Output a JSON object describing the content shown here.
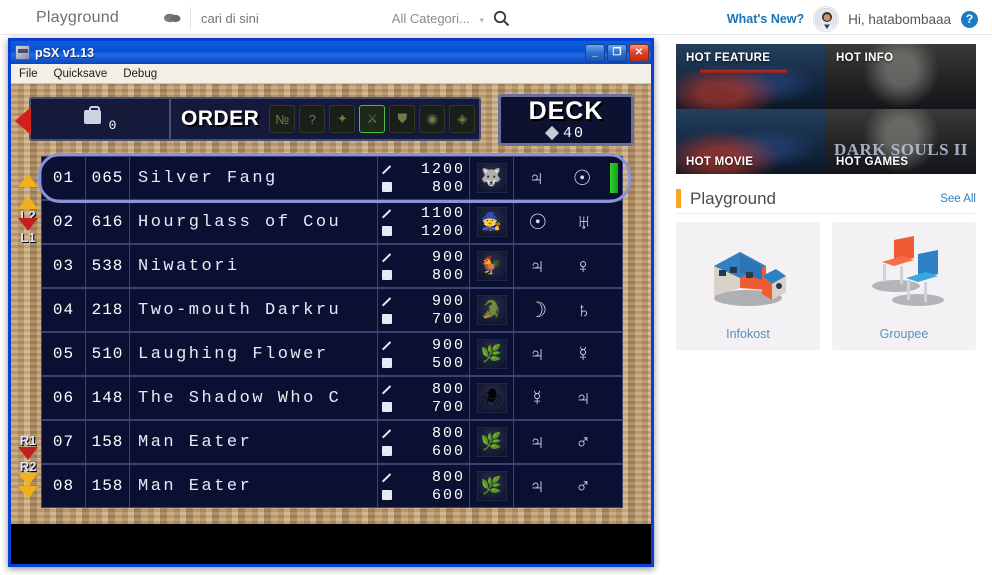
{
  "browser": {
    "brand": "Playground",
    "search": {
      "placeholder": "cari di sini",
      "category": "All Categori...",
      "category_caret": "▾",
      "search_icon": "search-icon",
      "bubble_icon": "chat-bubble-icon"
    },
    "header_right": {
      "whats_new": "What's New?",
      "greeting": "Hi, hatabombaaa",
      "help_icon": "?"
    },
    "promos": [
      {
        "label": "HOT FEATURE",
        "art": "avengers"
      },
      {
        "label": "HOT INFO",
        "art": "darksouls-top"
      },
      {
        "label": "HOT MOVIE",
        "art": "avengers-bottom"
      },
      {
        "label": "HOT GAMES",
        "art": "darksouls",
        "art_text": "DARK SOULS II"
      }
    ],
    "section": {
      "title": "Playground",
      "see_all": "See All"
    },
    "cards": [
      {
        "label": "Infokost",
        "icon": "house-isometric-icon"
      },
      {
        "label": "Groupee",
        "icon": "chairs-isometric-icon"
      }
    ]
  },
  "window": {
    "title": "pSX v1.13",
    "minimize": "_",
    "maximize": "❐",
    "close": "✕",
    "menu": [
      "File",
      "Quicksave",
      "Debug"
    ]
  },
  "game": {
    "order": {
      "bag_count": "0",
      "label": "ORDER",
      "filters": [
        {
          "name": "filter-number",
          "glyph": "№",
          "selected": false
        },
        {
          "name": "filter-type",
          "glyph": "?",
          "selected": false
        },
        {
          "name": "filter-monster",
          "glyph": "✦",
          "selected": false
        },
        {
          "name": "filter-attack",
          "glyph": "⚔",
          "selected": true
        },
        {
          "name": "filter-defense",
          "glyph": "⛊",
          "selected": false
        },
        {
          "name": "filter-trap",
          "glyph": "◉",
          "selected": false
        },
        {
          "name": "filter-magic",
          "glyph": "◈",
          "selected": false
        }
      ]
    },
    "deck": {
      "label": "DECK",
      "count": "40"
    },
    "hints_left": [
      {
        "label": "L2",
        "arrow": "up"
      },
      {
        "label": "L1",
        "arrow": "up"
      }
    ],
    "hints_right": [
      {
        "label": "R1",
        "arrow": "down-red"
      },
      {
        "label": "R2",
        "arrow": "down-yellow"
      }
    ],
    "rows": [
      {
        "no": "01",
        "id": "065",
        "name": "Silver Fang",
        "atk": "1200",
        "def": "800",
        "thumb": "🐺",
        "sym1": "♃",
        "sym2": "☉",
        "selected": true
      },
      {
        "no": "02",
        "id": "616",
        "name": "Hourglass of Cou",
        "atk": "1100",
        "def": "1200",
        "thumb": "🧙",
        "sym1": "☉",
        "sym2": "♅",
        "selected": false
      },
      {
        "no": "03",
        "id": "538",
        "name": "Niwatori",
        "atk": "900",
        "def": "800",
        "thumb": "🐓",
        "sym1": "♃",
        "sym2": "♀",
        "selected": false
      },
      {
        "no": "04",
        "id": "218",
        "name": "Two-mouth Darkru",
        "atk": "900",
        "def": "700",
        "thumb": "🐊",
        "sym1": "☽",
        "sym2": "♄",
        "selected": false
      },
      {
        "no": "05",
        "id": "510",
        "name": "Laughing Flower",
        "atk": "900",
        "def": "500",
        "thumb": "🌿",
        "sym1": "♃",
        "sym2": "☿",
        "selected": false
      },
      {
        "no": "06",
        "id": "148",
        "name": "The Shadow Who C",
        "atk": "800",
        "def": "700",
        "thumb": "🕷",
        "sym1": "☿",
        "sym2": "♃",
        "selected": false
      },
      {
        "no": "07",
        "id": "158",
        "name": "Man Eater",
        "atk": "800",
        "def": "600",
        "thumb": "🌿",
        "sym1": "♃",
        "sym2": "♂",
        "selected": false
      },
      {
        "no": "08",
        "id": "158",
        "name": "Man Eater",
        "atk": "800",
        "def": "600",
        "thumb": "🌿",
        "sym1": "♃",
        "sym2": "♂",
        "selected": false
      }
    ]
  }
}
